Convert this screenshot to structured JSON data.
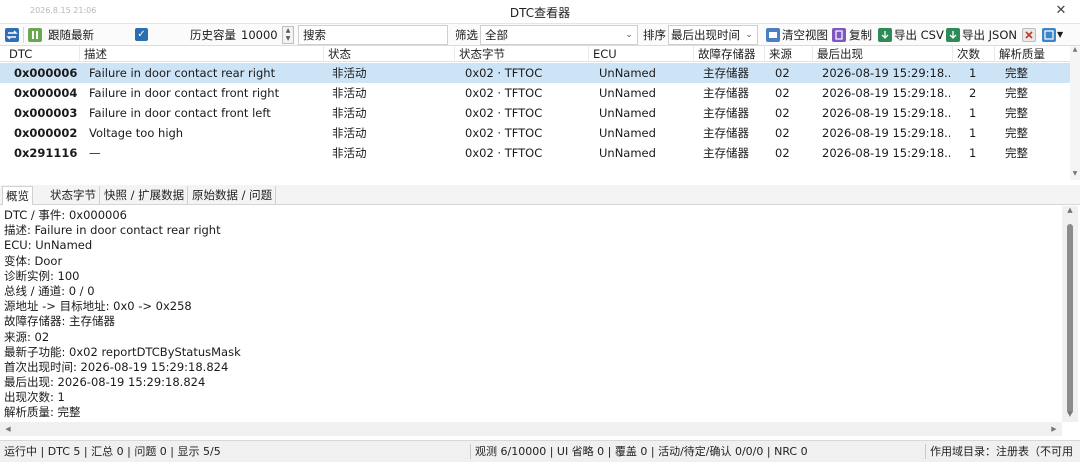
{
  "window": {
    "timestamp": "2026.8.15 21:06",
    "title": "DTC查看器",
    "close_glyph": "✕"
  },
  "toolbar": {
    "follow_label": "跟随最新",
    "history_label": "历史容量",
    "history_value": "10000",
    "search_placeholder": "搜索",
    "filter_label": "筛选",
    "filter_value": "全部",
    "sort_label": "排序",
    "sort_value": "最后出现时间",
    "clear_label": "清空视图",
    "copy_label": "复制",
    "export_csv_label": "导出 CSV",
    "export_json_label": "导出 JSON",
    "colors": {
      "swap_icon": "#2f6fb5",
      "pause_icon": "#6aa84f",
      "checkbox": "#2b6fb3",
      "clear_icon": "#4a7fc1",
      "copy_icon": "#7e57c2",
      "csv_icon": "#2e8b57",
      "json_icon": "#2e8b57",
      "delete_icon": "#c0392b",
      "export_icon": "#3d85c6"
    }
  },
  "table": {
    "columns": [
      "DTC",
      "描述",
      "状态",
      "状态字节",
      "ECU",
      "故障存储器",
      "来源",
      "最后出现",
      "次数",
      "解析质量"
    ],
    "rows": [
      {
        "dtc": "0x000006",
        "desc": "Failure in door contact rear right",
        "state": "非活动",
        "status_byte": "0x02 · TFTOC",
        "ecu": "UnNamed",
        "memory": "主存储器",
        "source": "02",
        "last": "2026-08-19 15:29:18....",
        "count": "1",
        "quality": "完整",
        "selected": true
      },
      {
        "dtc": "0x000004",
        "desc": "Failure in door contact front right",
        "state": "非活动",
        "status_byte": "0x02 · TFTOC",
        "ecu": "UnNamed",
        "memory": "主存储器",
        "source": "02",
        "last": "2026-08-19 15:29:18....",
        "count": "2",
        "quality": "完整",
        "selected": false
      },
      {
        "dtc": "0x000003",
        "desc": "Failure in door contact front left",
        "state": "非活动",
        "status_byte": "0x02 · TFTOC",
        "ecu": "UnNamed",
        "memory": "主存储器",
        "source": "02",
        "last": "2026-08-19 15:29:18....",
        "count": "1",
        "quality": "完整",
        "selected": false
      },
      {
        "dtc": "0x000002",
        "desc": "Voltage too high",
        "state": "非活动",
        "status_byte": "0x02 · TFTOC",
        "ecu": "UnNamed",
        "memory": "主存储器",
        "source": "02",
        "last": "2026-08-19 15:29:18....",
        "count": "1",
        "quality": "完整",
        "selected": false
      },
      {
        "dtc": "0x291116",
        "desc": "—",
        "state": "非活动",
        "status_byte": "0x02 · TFTOC",
        "ecu": "UnNamed",
        "memory": "主存储器",
        "source": "02",
        "last": "2026-08-19 15:29:18....",
        "count": "1",
        "quality": "完整",
        "selected": false
      }
    ],
    "selected_color": "#cde4f7"
  },
  "tabs": [
    "概览",
    "状态字节",
    "快照 / 扩展数据",
    "原始数据 / 问题"
  ],
  "detail": [
    "DTC / 事件: 0x000006",
    "描述: Failure in door contact rear right",
    "ECU: UnNamed",
    "变体: Door",
    "诊断实例: 100",
    "总线 / 通道: 0 / 0",
    "源地址 -> 目标地址: 0x0 -> 0x258",
    "故障存储器: 主存储器",
    "来源: 02",
    "最新子功能: 0x02 reportDTCByStatusMask",
    "首次出现时间: 2026-08-19 15:29:18.824",
    "最后出现: 2026-08-19 15:29:18.824",
    "出现次数: 1",
    "解析质量: 完整"
  ],
  "status": {
    "left": "运行中 | DTC 5 | 汇总 0 | 问题 0 | 显示 5/5",
    "middle": "观测 6/10000 | UI 省略 0 | 覆盖 0 | 活动/待定/确认 0/0/0 | NRC 0",
    "right": "作用域目录：注册表（不可用"
  }
}
